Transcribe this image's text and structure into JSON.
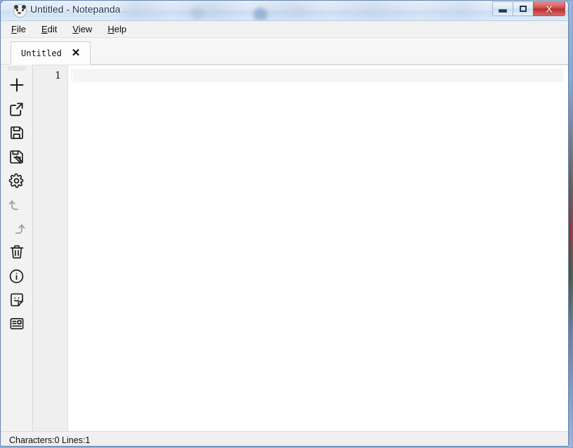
{
  "window": {
    "title": "Untitled - Notepanda",
    "app_icon": "panda-icon",
    "controls": {
      "minimize": "minimize-icon",
      "maximize": "maximize-icon",
      "close": "X"
    }
  },
  "menubar": {
    "items": [
      {
        "name": "file",
        "mnemonic": "F",
        "rest": "ile"
      },
      {
        "name": "edit",
        "mnemonic": "E",
        "rest": "dit"
      },
      {
        "name": "view",
        "mnemonic": "V",
        "rest": "iew"
      },
      {
        "name": "help",
        "mnemonic": "H",
        "rest": "elp"
      }
    ]
  },
  "tabs": [
    {
      "label": "Untitled",
      "close_label": "✕",
      "active": true
    }
  ],
  "toolbar": {
    "grip": "drag-handle",
    "buttons": [
      {
        "name": "new-file-button",
        "icon": "plus-icon",
        "enabled": true
      },
      {
        "name": "open-file-button",
        "icon": "open-external-icon",
        "enabled": true
      },
      {
        "name": "save-button",
        "icon": "floppy-disk-icon",
        "enabled": true
      },
      {
        "name": "save-as-button",
        "icon": "floppy-disk-pencil-icon",
        "enabled": true
      },
      {
        "name": "settings-button",
        "icon": "gear-icon",
        "enabled": true
      },
      {
        "name": "undo-button",
        "icon": "undo-arrow-icon",
        "enabled": false
      },
      {
        "name": "redo-button",
        "icon": "redo-arrow-icon",
        "enabled": false
      },
      {
        "name": "delete-button",
        "icon": "trash-icon",
        "enabled": true
      },
      {
        "name": "about-button",
        "icon": "info-circle-icon",
        "enabled": true
      },
      {
        "name": "sticker-button",
        "icon": "smiley-note-icon",
        "enabled": true
      },
      {
        "name": "layout-button",
        "icon": "article-layout-icon",
        "enabled": true
      }
    ]
  },
  "editor": {
    "line_numbers": [
      "1"
    ],
    "content": "",
    "placeholder": ""
  },
  "statusbar": {
    "text": "Characters:0 Lines:1",
    "characters": 0,
    "lines": 1
  },
  "colors": {
    "titlebar_text": "#17334f",
    "close_button": "#cf4b4b",
    "toolbar_bg": "#f2f2f2",
    "gutter_bg": "#efefef",
    "editor_bg": "#ffffff",
    "current_line": "#f5f5f5",
    "window_border": "#5f83b0"
  }
}
